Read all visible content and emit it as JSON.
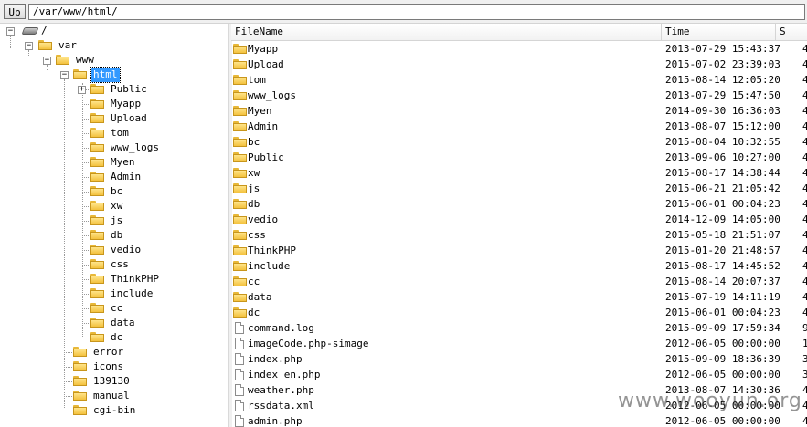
{
  "toolbar": {
    "up_label": "Up",
    "path": "/var/www/html/"
  },
  "tree": {
    "root": "/",
    "var": "var",
    "www": "www",
    "html": "html",
    "html_children": [
      "Public",
      "Myapp",
      "Upload",
      "tom",
      "www_logs",
      "Myen",
      "Admin",
      "bc",
      "xw",
      "js",
      "db",
      "vedio",
      "css",
      "ThinkPHP",
      "include",
      "cc",
      "data",
      "dc"
    ],
    "www_children": [
      "error",
      "icons",
      "139130",
      "manual",
      "cgi-bin"
    ]
  },
  "list": {
    "columns": [
      "FileName",
      "Time",
      "S"
    ],
    "rows": [
      {
        "name": "Myapp",
        "time": "2013-07-29 15:43:37",
        "size": "4",
        "type": "folder"
      },
      {
        "name": "Upload",
        "time": "2015-07-02 23:39:03",
        "size": "4",
        "type": "folder"
      },
      {
        "name": "tom",
        "time": "2015-08-14 12:05:20",
        "size": "4",
        "type": "folder"
      },
      {
        "name": "www_logs",
        "time": "2013-07-29 15:47:50",
        "size": "4",
        "type": "folder"
      },
      {
        "name": "Myen",
        "time": "2014-09-30 16:36:03",
        "size": "4",
        "type": "folder"
      },
      {
        "name": "Admin",
        "time": "2013-08-07 15:12:00",
        "size": "4",
        "type": "folder"
      },
      {
        "name": "bc",
        "time": "2015-08-04 10:32:55",
        "size": "4",
        "type": "folder"
      },
      {
        "name": "Public",
        "time": "2013-09-06 10:27:00",
        "size": "4",
        "type": "folder"
      },
      {
        "name": "xw",
        "time": "2015-08-17 14:38:44",
        "size": "4",
        "type": "folder"
      },
      {
        "name": "js",
        "time": "2015-06-21 21:05:42",
        "size": "4",
        "type": "folder"
      },
      {
        "name": "db",
        "time": "2015-06-01 00:04:23",
        "size": "4",
        "type": "folder"
      },
      {
        "name": "vedio",
        "time": "2014-12-09 14:05:00",
        "size": "4",
        "type": "folder"
      },
      {
        "name": "css",
        "time": "2015-05-18 21:51:07",
        "size": "4",
        "type": "folder"
      },
      {
        "name": "ThinkPHP",
        "time": "2015-01-20 21:48:57",
        "size": "4",
        "type": "folder"
      },
      {
        "name": "include",
        "time": "2015-08-17 14:45:52",
        "size": "4",
        "type": "folder"
      },
      {
        "name": "cc",
        "time": "2015-08-14 20:07:37",
        "size": "4",
        "type": "folder"
      },
      {
        "name": "data",
        "time": "2015-07-19 14:11:19",
        "size": "4",
        "type": "folder"
      },
      {
        "name": "dc",
        "time": "2015-06-01 00:04:23",
        "size": "4",
        "type": "folder"
      },
      {
        "name": "command.log",
        "time": "2015-09-09 17:59:34",
        "size": "9",
        "type": "file"
      },
      {
        "name": "imageCode.php-simage",
        "time": "2012-06-05 00:00:00",
        "size": "1",
        "type": "file"
      },
      {
        "name": "index.php",
        "time": "2015-09-09 18:36:39",
        "size": "3",
        "type": "file"
      },
      {
        "name": "index_en.php",
        "time": "2012-06-05 00:00:00",
        "size": "3",
        "type": "file"
      },
      {
        "name": "weather.php",
        "time": "2013-08-07 14:30:36",
        "size": "4",
        "type": "file"
      },
      {
        "name": "rssdata.xml",
        "time": "2012-06-05 00:00:00",
        "size": "4",
        "type": "file"
      },
      {
        "name": "admin.php",
        "time": "2012-06-05 00:00:00",
        "size": "4",
        "type": "file"
      }
    ]
  },
  "watermark": "www.wooyun.org"
}
